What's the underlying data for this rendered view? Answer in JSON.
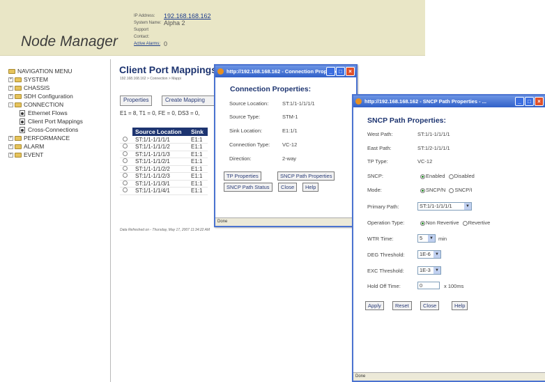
{
  "header": {
    "app_title": "Node Manager",
    "fields": [
      {
        "label": "IP Address:",
        "value": "192.168.168.162",
        "link": true
      },
      {
        "label": "System Name:",
        "value": "Alpha 2",
        "link": false
      },
      {
        "label": "Support Contact:",
        "value": "",
        "link": false
      },
      {
        "label": "Active Alarms:",
        "value": "0",
        "link": false
      }
    ]
  },
  "nav": {
    "title": "NAVIGATION MENU",
    "items": [
      {
        "label": "SYSTEM",
        "kind": "folder",
        "sign": "+"
      },
      {
        "label": "CHASSIS",
        "kind": "folder",
        "sign": "+"
      },
      {
        "label": "SDH Configuration",
        "kind": "folder",
        "sign": "+"
      },
      {
        "label": "CONNECTION",
        "kind": "folder",
        "sign": "-"
      },
      {
        "label": "Ethernet Flows",
        "kind": "doc",
        "sign": ""
      },
      {
        "label": "Client Port Mappings",
        "kind": "doc",
        "sign": ""
      },
      {
        "label": "Cross-Connections",
        "kind": "doc",
        "sign": ""
      },
      {
        "label": "PERFORMANCE",
        "kind": "folder",
        "sign": "+"
      },
      {
        "label": "ALARM",
        "kind": "folder",
        "sign": "+"
      },
      {
        "label": "EVENT",
        "kind": "folder",
        "sign": "+"
      }
    ]
  },
  "main": {
    "title": "Client Port Mappings",
    "breadcrumb": "192.168.168.162 > Connection > Mappi",
    "btn_properties": "Properties",
    "btn_create": "Create Mapping",
    "filter": "E1 = 8, T1 = 0, FE = 0, DS3 = 0,",
    "columns": [
      "Source Location",
      "Sink"
    ],
    "rows": [
      [
        "ST:1/1-1/1/1/1",
        "E1:1"
      ],
      [
        "ST:1/1-1/1/1/2",
        "E1:1"
      ],
      [
        "ST:1/1-1/1/1/3",
        "E1:1"
      ],
      [
        "ST:1/1-1/1/2/1",
        "E1:1"
      ],
      [
        "ST:1/1-1/1/2/2",
        "E1:1"
      ],
      [
        "ST:1/1-1/1/2/3",
        "E1:1"
      ],
      [
        "ST:1/1-1/1/3/1",
        "E1:1"
      ],
      [
        "ST:1/1-1/1/4/1",
        "E1:1"
      ]
    ],
    "refreshed": "Data Refreshed on - Thursday, May 17, 2007 11:34:22 AM"
  },
  "conn_window": {
    "title": "http://192.168.168.162 - Connection Properties - ...",
    "heading": "Connection Properties:",
    "props": [
      {
        "label": "Source Location:",
        "value": "ST:1/1-1/1/1/1"
      },
      {
        "label": "Source Type:",
        "value": "STM-1"
      },
      {
        "label": "Sink Location:",
        "value": "E1:1/1"
      },
      {
        "label": "Connection Type:",
        "value": "VC-12"
      },
      {
        "label": "Direction:",
        "value": "2-way"
      }
    ],
    "btn_tp": "TP Properties",
    "btn_snc": "SNCP Path Properties",
    "btn_status": "SNCP Path Status",
    "btn_close": "Close",
    "btn_help": "Help",
    "status": "Done"
  },
  "sncp_window": {
    "title": "http://192.168.168.162 - SNCP Path Properties - ...",
    "heading": "SNCP Path Properties:",
    "west_label": "West Path:",
    "west_value": "ST:1/1-1/1/1/1",
    "east_label": "East Path:",
    "east_value": "ST:1/2-1/1/1/1",
    "tp_label": "TP Type:",
    "tp_value": "VC-12",
    "sncp_label": "SNCP:",
    "sncp_enabled": "Enabled",
    "sncp_disabled": "Disabled",
    "mode_label": "Mode:",
    "mode_n": "SNCP/N",
    "mode_i": "SNCP/I",
    "primary_label": "Primary Path:",
    "primary_value": "ST:1/1-1/1/1/1",
    "optype_label": "Operation Type:",
    "optype_nonrev": "Non Revertive",
    "optype_rev": "Revertive",
    "wtr_label": "WTR Time:",
    "wtr_value": "5",
    "wtr_unit": "min",
    "deg_label": "DEG Threshold:",
    "deg_value": "1E-6",
    "exc_label": "EXC Threshold:",
    "exc_value": "1E-3",
    "hold_label": "Hold Off Time:",
    "hold_value": "0",
    "hold_unit": "x 100ms",
    "btn_apply": "Apply",
    "btn_reset": "Reset",
    "btn_close": "Close",
    "btn_help": "Help",
    "status": "Done"
  }
}
